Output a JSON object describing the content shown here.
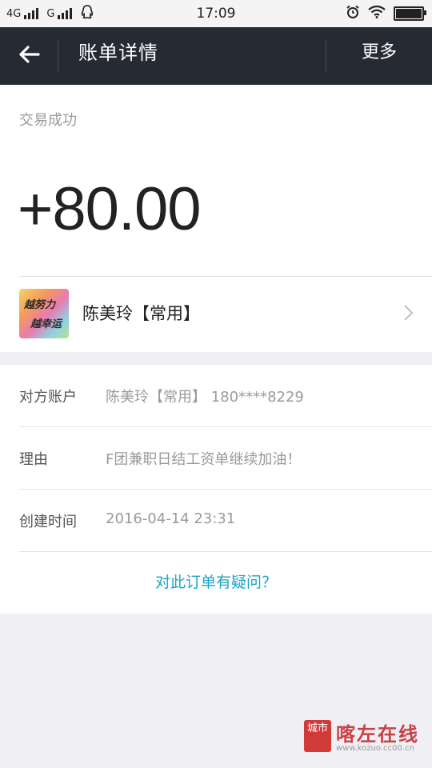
{
  "status_bar": {
    "network1": "4G",
    "network2": "G",
    "time": "17:09",
    "battery_level": 1.0
  },
  "nav": {
    "back_icon": "arrow-left-icon",
    "title": "账单详情",
    "more_label": "更多"
  },
  "summary": {
    "status": "交易成功",
    "amount": "+80.00",
    "counterparty_name": "陈美玲【常用】",
    "avatar_text_line1": "越努力",
    "avatar_text_line2": "越幸运"
  },
  "details": {
    "rows": [
      {
        "label": "对方账户",
        "value": "陈美玲【常用】 180****8229"
      },
      {
        "label": "理由",
        "value": "F团兼职日结工资单继续加油！"
      },
      {
        "label": "创建时间",
        "value": "2016-04-14 23:31"
      }
    ],
    "question_link": "对此订单有疑问？"
  },
  "watermark": {
    "badge": "城市",
    "name": "喀左在线",
    "url": "www.kozuo.cc00.cn"
  },
  "colors": {
    "navbar": "#262a33",
    "link": "#1ea3c6",
    "background": "#efeff4"
  }
}
